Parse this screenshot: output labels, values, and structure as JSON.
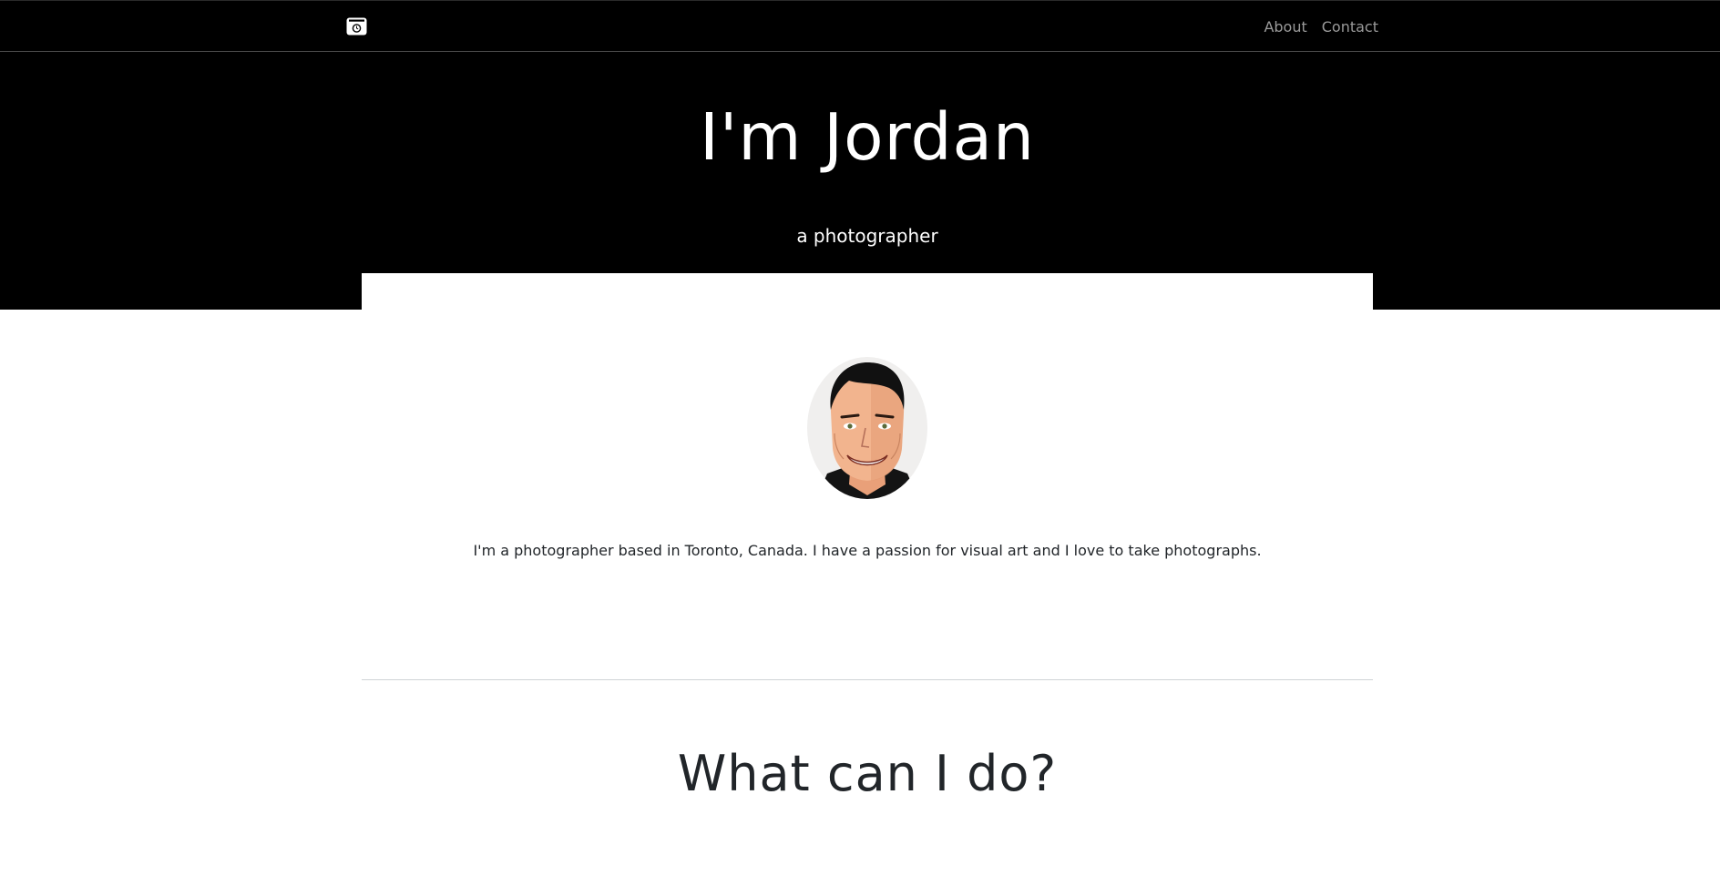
{
  "nav": {
    "brand_icon": "camera-icon",
    "links": [
      {
        "label": "About"
      },
      {
        "label": "Contact"
      }
    ]
  },
  "hero": {
    "title": "I'm Jordan",
    "subtitle": "a photographer"
  },
  "about": {
    "avatar_icon": "avatar-illustration",
    "text": "I'm a photographer based in Toronto, Canada. I have a passion for visual art and I love to take photographs."
  },
  "services": {
    "title": "What can I do?"
  },
  "colors": {
    "header_bg": "#000000",
    "nav_link": "#9a9a9a",
    "body_text": "#212529"
  }
}
